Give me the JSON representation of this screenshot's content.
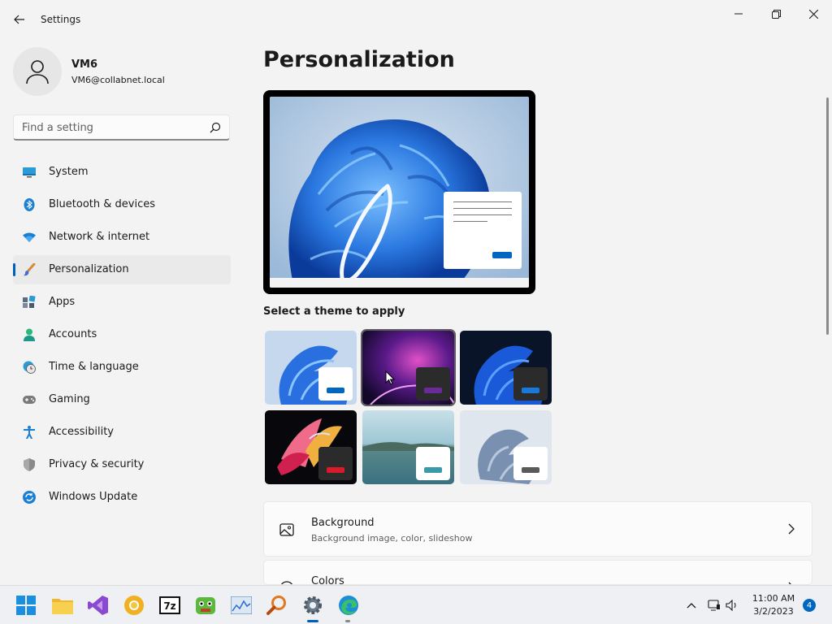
{
  "window": {
    "title": "Settings"
  },
  "account": {
    "name": "VM6",
    "email": "VM6@collabnet.local"
  },
  "search": {
    "placeholder": "Find a setting"
  },
  "nav": {
    "items": [
      {
        "label": "System",
        "icon": "monitor-icon"
      },
      {
        "label": "Bluetooth & devices",
        "icon": "bluetooth-icon"
      },
      {
        "label": "Network & internet",
        "icon": "wifi-icon"
      },
      {
        "label": "Personalization",
        "icon": "brush-icon",
        "selected": true
      },
      {
        "label": "Apps",
        "icon": "apps-icon"
      },
      {
        "label": "Accounts",
        "icon": "person-icon"
      },
      {
        "label": "Time & language",
        "icon": "clock-globe-icon"
      },
      {
        "label": "Gaming",
        "icon": "gamepad-icon"
      },
      {
        "label": "Accessibility",
        "icon": "accessibility-icon"
      },
      {
        "label": "Privacy & security",
        "icon": "shield-icon"
      },
      {
        "label": "Windows Update",
        "icon": "update-icon"
      }
    ]
  },
  "main": {
    "title": "Personalization",
    "themes_label": "Select a theme to apply",
    "cards": [
      {
        "title": "Background",
        "subtitle": "Background image, color, slideshow"
      },
      {
        "title": "Colors",
        "subtitle": ""
      }
    ]
  },
  "taskbar": {
    "time": "11:00 AM",
    "date": "3/2/2023",
    "notifications": "4"
  },
  "colors": {
    "accent": "#005fb8",
    "background": "#f3f3f3"
  }
}
